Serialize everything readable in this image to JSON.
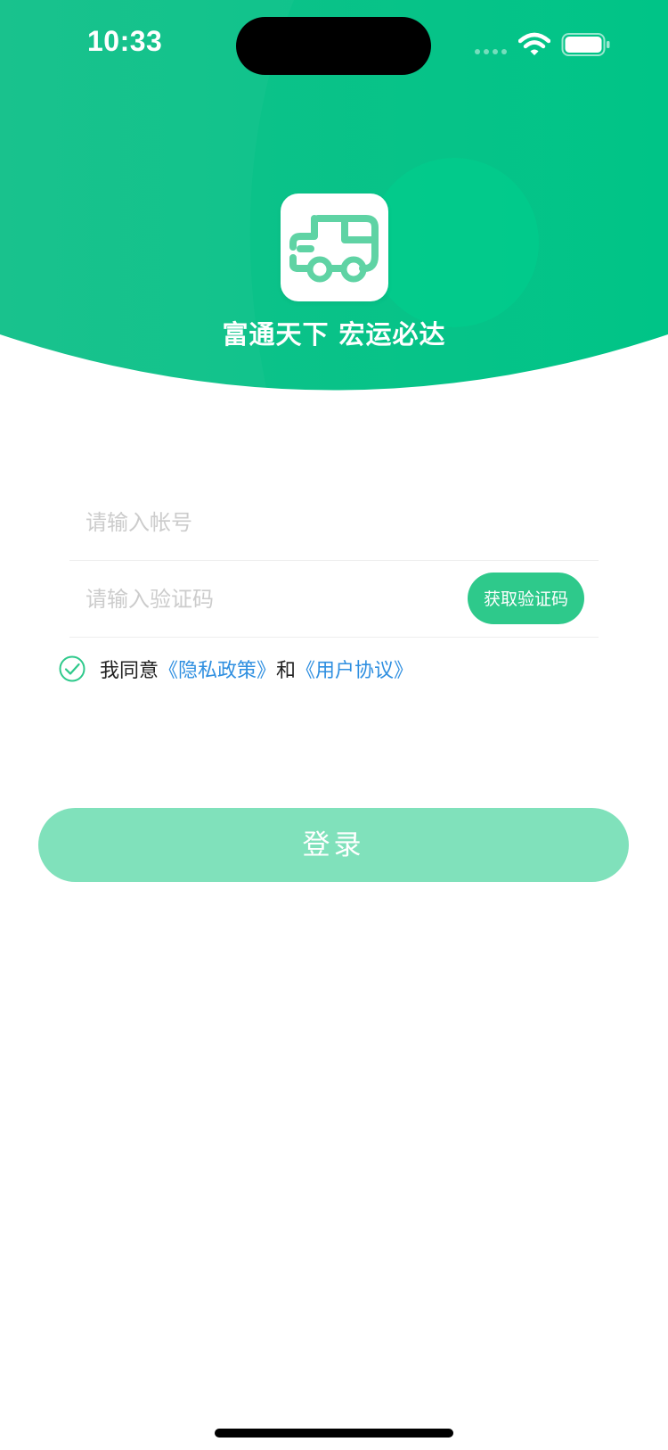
{
  "status_bar": {
    "time": "10:33"
  },
  "header": {
    "slogan": "富通天下 宏运必达",
    "logo_icon": "delivery-truck-icon",
    "colors": {
      "primary": "#00C287",
      "primary_light": "#00D18F"
    }
  },
  "form": {
    "account_placeholder": "请输入帐号",
    "account_value": "",
    "code_placeholder": "请输入验证码",
    "code_value": "",
    "get_code_label": "获取验证码"
  },
  "agreement": {
    "checked": true,
    "prefix": "我同意",
    "privacy_label": "《隐私政策》",
    "and": "和",
    "user_label": "《用户协议》"
  },
  "login": {
    "label": "登录",
    "color": "#80E1BB"
  }
}
